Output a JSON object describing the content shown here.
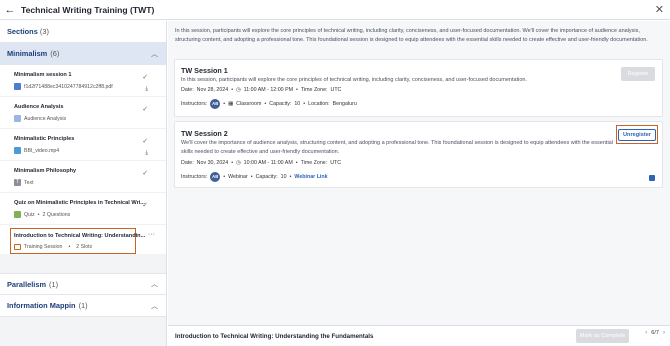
{
  "window": {
    "title": "Technical Writing Training (TWT)"
  },
  "sidebar": {
    "sections_label": "Sections",
    "sections_count": "(3)",
    "groups": [
      {
        "title": "Minimalism",
        "count": "(6)"
      },
      {
        "title": "Parallelism",
        "count": "(1)"
      },
      {
        "title": "Information Mappin",
        "count": "(1)"
      }
    ],
    "items": [
      {
        "name": "Minimalism session 1",
        "sub": "f1d2f71488ec3410247784912c2ff8.pdf",
        "icon": "pdf-file-icon",
        "completed": true,
        "downloadable": true
      },
      {
        "name": "Audience Analysis",
        "sub": "Audience Analysis",
        "icon": "audio-icon",
        "completed": true,
        "downloadable": false
      },
      {
        "name": "Minimalistic Principles",
        "sub": "BBI_video.mp4",
        "icon": "video-icon",
        "completed": true,
        "downloadable": true
      },
      {
        "name": "Minimalism Philosophy",
        "sub": "Text",
        "icon": "text-icon",
        "completed": true,
        "downloadable": false
      },
      {
        "name": "Quiz on Minimalistic Principles in Technical Wri...",
        "sub": "Quiz",
        "sub_extra": "2 Questions",
        "icon": "quiz-icon",
        "completed": true,
        "downloadable": false
      },
      {
        "name": "Introduction to Technical Writing: Understandin...",
        "sub": "Training Session",
        "sub_extra": "2 Slots",
        "icon": "training-session-icon",
        "selected": true
      }
    ]
  },
  "main": {
    "intro": "In this session, participants will explore the core principles of technical writing, including clarity, conciseness, and user-focused documentation. We'll cover the importance of audience analysis, structuring content, and adopting a professional tone. This foundational session is designed to equip attendees with the essential skills needed to create effective and user-friendly documentation.",
    "sessions": [
      {
        "title": "TW Session 1",
        "desc": "In this session, participants will explore the core principles of technical writing, including clarity, conciseness, and user-focused documentation.",
        "date_label": "Date:",
        "date": "Nov 28, 2024",
        "time": "11:00 AM - 12:00 PM",
        "timezone_label": "Time Zone:",
        "timezone": "UTC",
        "instructors_label": "Instructors:",
        "avatar": "AB",
        "mode": "Classroom",
        "capacity_label": "Capacity:",
        "capacity": "10",
        "location_label": "Location:",
        "location": "Bengaluru",
        "button": "Register"
      },
      {
        "title": "TW Session 2",
        "desc": "We'll cover the importance of audience analysis, structuring content, and adopting a professional tone. This foundational session is designed to equip attendees with the essential skills needed to create effective and user-friendly documentation.",
        "date_label": "Date:",
        "date": "Nov 30, 2024",
        "time": "10:00 AM - 11:00 AM",
        "timezone_label": "Time Zone:",
        "timezone": "UTC",
        "instructors_label": "Instructors:",
        "avatar": "AB",
        "mode": "Webinar",
        "capacity_label": "Capacity:",
        "capacity": "10",
        "link": "Webinar Link",
        "button": "Unregister"
      }
    ]
  },
  "footer": {
    "title": "Introduction to Technical Writing: Understanding the Fundamentals",
    "complete_button": "Mark as Complete",
    "page": "6/7"
  },
  "colors": {
    "accent": "#2d63b8",
    "highlight": "#c8632a",
    "check": "#3b8a3d"
  }
}
